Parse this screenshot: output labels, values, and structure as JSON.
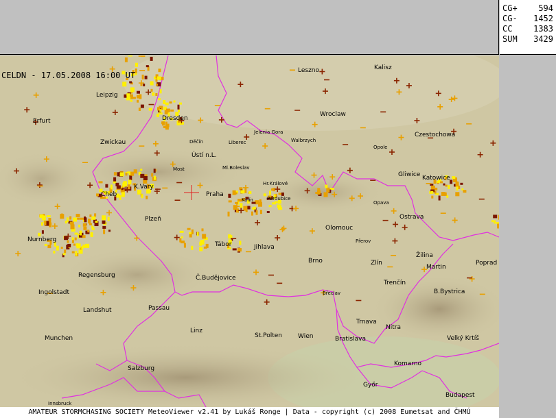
{
  "stats": {
    "rows": [
      {
        "label": "CG+",
        "value": "594"
      },
      {
        "label": "CG-",
        "value": "1452"
      },
      {
        "label": "CC",
        "value": "1383"
      },
      {
        "label": "SUM",
        "value": "3429"
      }
    ]
  },
  "map": {
    "header": "CELDN - 17.05.2008 16:00 UT",
    "footer": "AMATEUR STORMCHASING SOCIETY MeteoViewer v2.41 by Lukáš Ronge | Data - copyright (c) 2008 Eumetsat and ČHMÚ",
    "colors": {
      "background": "#cfc7a3",
      "border": "#e030e0",
      "strike_recent": "#fff000",
      "strike_mid": "#e8a000",
      "strike_old": "#7a1500",
      "strike_marker": "#8b2500"
    },
    "cities": [
      {
        "name": "Leszno"
      },
      {
        "name": "Kalisz"
      },
      {
        "name": "Leipzig"
      },
      {
        "name": "Erfurt"
      },
      {
        "name": "Dresden"
      },
      {
        "name": "Wroclaw"
      },
      {
        "name": "Jelenia Gora"
      },
      {
        "name": "Walbrzych"
      },
      {
        "name": "Czestochowa"
      },
      {
        "name": "Zwickau"
      },
      {
        "name": "Děčín"
      },
      {
        "name": "Liberec"
      },
      {
        "name": "Opole"
      },
      {
        "name": "Ústí n.L."
      },
      {
        "name": "Most"
      },
      {
        "name": "Ml.Boleslav"
      },
      {
        "name": "Gliwice"
      },
      {
        "name": "Katowice"
      },
      {
        "name": "K.Vary"
      },
      {
        "name": "Hr.Králové"
      },
      {
        "name": "Cheb"
      },
      {
        "name": "Praha"
      },
      {
        "name": "Kolín"
      },
      {
        "name": "Pardubice"
      },
      {
        "name": "Opava"
      },
      {
        "name": "Plzeň"
      },
      {
        "name": "Ostrava"
      },
      {
        "name": "Nurnberg"
      },
      {
        "name": "Olomouc"
      },
      {
        "name": "Přerov"
      },
      {
        "name": "Tábor"
      },
      {
        "name": "Jihlava"
      },
      {
        "name": "Žilina"
      },
      {
        "name": "Poprad"
      },
      {
        "name": "Brno"
      },
      {
        "name": "Zlín"
      },
      {
        "name": "Martin"
      },
      {
        "name": "Regensburg"
      },
      {
        "name": "Č.Budějovice"
      },
      {
        "name": "Trenčín"
      },
      {
        "name": "Ingolstadt"
      },
      {
        "name": "B.Bystrica"
      },
      {
        "name": "Břeclav"
      },
      {
        "name": "Passau"
      },
      {
        "name": "Landshut"
      },
      {
        "name": "Trnava"
      },
      {
        "name": "Nitra"
      },
      {
        "name": "Linz"
      },
      {
        "name": "St.Polten"
      },
      {
        "name": "Wien"
      },
      {
        "name": "Bratislava"
      },
      {
        "name": "Munchen"
      },
      {
        "name": "Velký Krtíš"
      },
      {
        "name": "Komarno"
      },
      {
        "name": "Salzburg"
      },
      {
        "name": "Győr"
      },
      {
        "name": "Budapest"
      },
      {
        "name": "Innsbruck"
      }
    ]
  }
}
